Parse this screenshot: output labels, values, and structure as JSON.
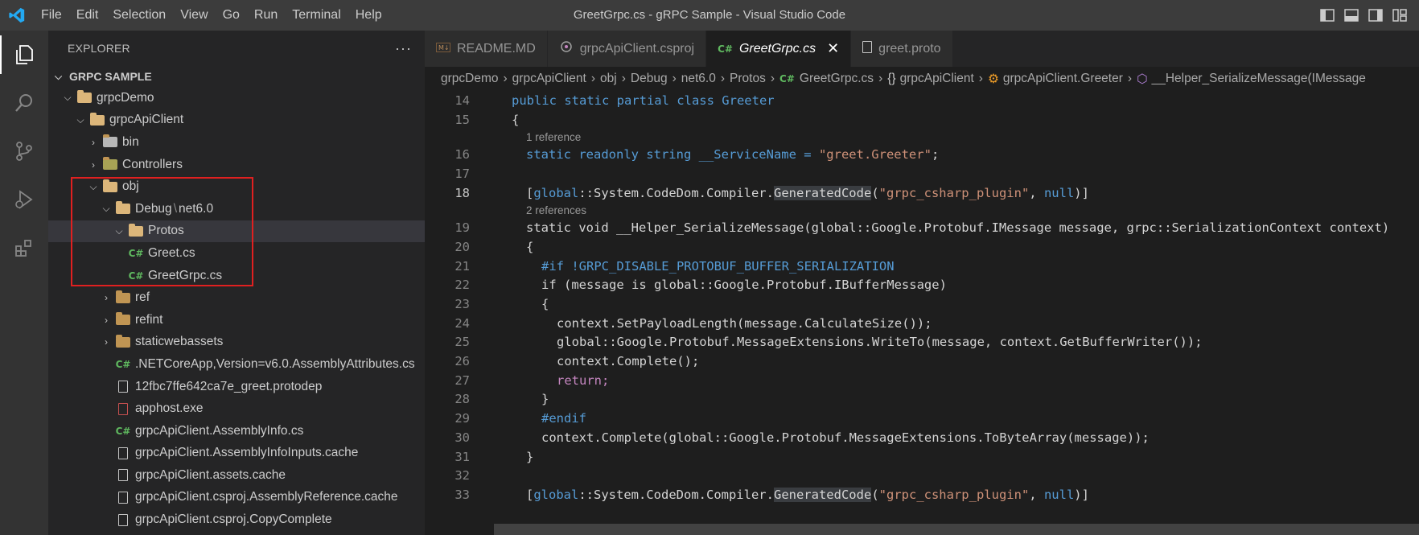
{
  "titlebar": {
    "menu": [
      "File",
      "Edit",
      "Selection",
      "View",
      "Go",
      "Run",
      "Terminal",
      "Help"
    ],
    "title": "GreetGrpc.cs - gRPC Sample - Visual Studio Code"
  },
  "activity": [
    "explorer-icon",
    "search-icon",
    "source-control-icon",
    "run-debug-icon",
    "extensions-icon"
  ],
  "sidebar": {
    "title": "EXPLORER",
    "more": "···",
    "section": "GRPC SAMPLE",
    "tree": [
      {
        "label": "grpcDemo"
      },
      {
        "label": "grpcApiClient"
      },
      {
        "label": "bin"
      },
      {
        "label": "Controllers"
      },
      {
        "label": "obj"
      },
      {
        "label": "Debug",
        "label2": "net6.0"
      },
      {
        "label": "Protos"
      },
      {
        "label": "Greet.cs"
      },
      {
        "label": "GreetGrpc.cs"
      },
      {
        "label": "ref"
      },
      {
        "label": "refint"
      },
      {
        "label": "staticwebassets"
      },
      {
        "label": ".NETCoreApp,Version=v6.0.AssemblyAttributes.cs"
      },
      {
        "label": "12fbc7ffe642ca7e_greet.protodep"
      },
      {
        "label": "apphost.exe"
      },
      {
        "label": "grpcApiClient.AssemblyInfo.cs"
      },
      {
        "label": "grpcApiClient.AssemblyInfoInputs.cache"
      },
      {
        "label": "grpcApiClient.assets.cache"
      },
      {
        "label": "grpcApiClient.csproj.AssemblyReference.cache"
      },
      {
        "label": "grpcApiClient.csproj.CopyComplete"
      }
    ]
  },
  "tabs": [
    {
      "label": "README.MD"
    },
    {
      "label": "grpcApiClient.csproj"
    },
    {
      "label": "GreetGrpc.cs",
      "close": "✕"
    },
    {
      "label": "greet.proto"
    }
  ],
  "breadcrumb": [
    "grpcDemo",
    "grpcApiClient",
    "obj",
    "Debug",
    "net6.0",
    "Protos",
    "GreetGrpc.cs",
    "grpcApiClient",
    "grpcApiClient.Greeter",
    "__Helper_SerializeMessage(IMessage"
  ],
  "code": {
    "l14": {
      "n": "14",
      "t": "public static partial class Greeter"
    },
    "l15": {
      "n": "15",
      "t": "{"
    },
    "lens1": "1 reference",
    "l16": {
      "n": "16",
      "a": "static readonly string __ServiceName = ",
      "s": "\"greet.Greeter\"",
      "b": ";"
    },
    "l17": {
      "n": "17"
    },
    "l18": {
      "n": "18",
      "g": "global",
      "a": "::System.CodeDom.Compiler.",
      "h": "GeneratedCode",
      "s": "\"grpc_csharp_plugin\"",
      "k": "null"
    },
    "lens2": "2 references",
    "l19": {
      "n": "19",
      "t": "static void __Helper_SerializeMessage(global::Google.Protobuf.IMessage message, grpc::SerializationContext context)"
    },
    "l20": {
      "n": "20",
      "t": "{"
    },
    "l21": {
      "n": "21",
      "t": "#if !GRPC_DISABLE_PROTOBUF_BUFFER_SERIALIZATION"
    },
    "l22": {
      "n": "22",
      "t": "if (message is global::Google.Protobuf.IBufferMessage)"
    },
    "l23": {
      "n": "23",
      "t": "{"
    },
    "l24": {
      "n": "24",
      "t": "context.SetPayloadLength(message.CalculateSize());"
    },
    "l25": {
      "n": "25",
      "t": "global::Google.Protobuf.MessageExtensions.WriteTo(message, context.GetBufferWriter());"
    },
    "l26": {
      "n": "26",
      "t": "context.Complete();"
    },
    "l27": {
      "n": "27",
      "t": "return;"
    },
    "l28": {
      "n": "28",
      "t": "}"
    },
    "l29": {
      "n": "29",
      "t": "#endif"
    },
    "l30": {
      "n": "30",
      "t": "context.Complete(global::Google.Protobuf.MessageExtensions.ToByteArray(message));"
    },
    "l31": {
      "n": "31",
      "t": "}"
    },
    "l32": {
      "n": "32"
    },
    "l33": {
      "n": "33"
    }
  }
}
